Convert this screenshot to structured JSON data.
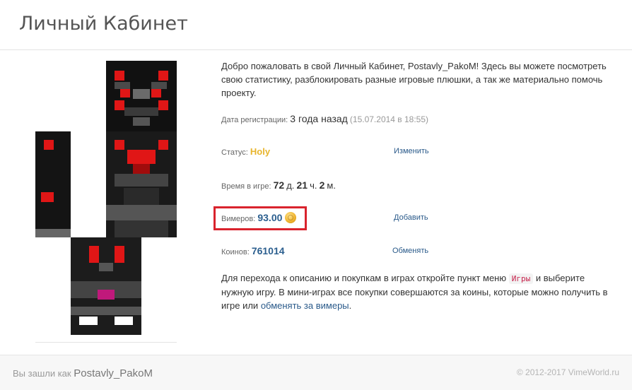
{
  "header": {
    "title": "Личный Кабинет"
  },
  "welcome": {
    "text": "Добро пожаловать в свой Личный Кабинет, Postavly_PakoM! Здесь вы можете посмотреть свою статистику, разблокировать разные игровые плюшки, а так же материально помочь проекту."
  },
  "registration": {
    "label": "Дата регистрации:",
    "relative": "3 года назад",
    "date": "(15.07.2014 в 18:55)"
  },
  "status": {
    "label": "Статус:",
    "value": "Holy",
    "action": "Изменить",
    "value_color": "#e8b52d"
  },
  "playtime": {
    "label": "Время в игре:",
    "days": "72",
    "days_unit": "д.",
    "hours": "21",
    "hours_unit": "ч.",
    "minutes": "2",
    "minutes_unit": "м."
  },
  "vimers": {
    "label": "Вимеров:",
    "value": "93.00",
    "action": "Добавить",
    "icon": "gold-coin-icon",
    "highlight_color": "#d9232d"
  },
  "coins": {
    "label": "Коинов:",
    "value": "761014",
    "action": "Обменять"
  },
  "info": {
    "text_before": "Для перехода к описанию и покупкам в играх откройте пункт меню",
    "menu_tag": "Игры",
    "text_middle": "и выберите нужную игру. В мини-играх все покупки совершаются за коины, которые можно получить в игре или",
    "link": "обменять за вимеры",
    "text_end": "."
  },
  "footer": {
    "logged_as": "Вы зашли как",
    "username": "Postavly_PakoM",
    "copyright": "© 2012-2017 VimeWorld.ru"
  },
  "skin": {
    "icon": "player-skin-avatar"
  }
}
